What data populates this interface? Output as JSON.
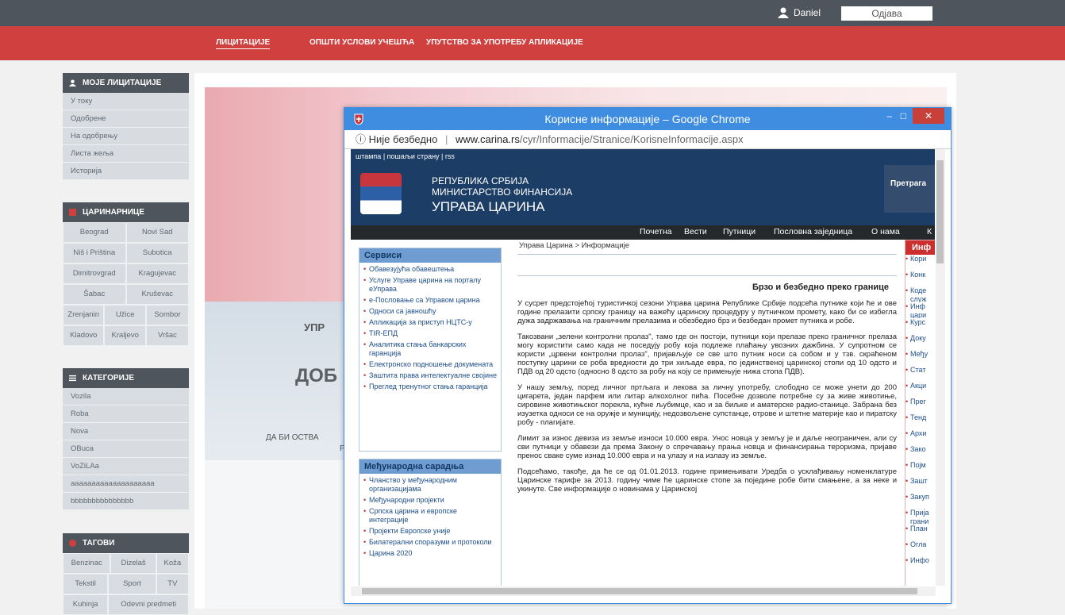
{
  "top": {
    "user": "Daniel",
    "logout": "Одјава"
  },
  "nav": {
    "items": [
      "ЛИЦИТАЦИЈЕ",
      "ОПШТИ УСЛОВИ УЧЕШЋА",
      "УПУТСТВО ЗА УПОТРЕБУ АПЛИКАЦИЈЕ"
    ]
  },
  "sidebar": {
    "auctions": {
      "title": "МОЈЕ ЛИЦИТАЦИЈЕ",
      "items": [
        "У току",
        "Одобрене",
        "На одобрењу",
        "Листа жеља",
        "Историја"
      ]
    },
    "customs": {
      "title": "ЦАРИНАРНИЦЕ",
      "items": [
        "Beograd",
        "Novi Sad",
        "Niš i Priština",
        "Subotica",
        "Dimitrovgrad",
        "Kragujevac",
        "Šabac",
        "Kruševac",
        "Zrenjanin",
        "Užice",
        "Sombor",
        "Kladovo",
        "Kraljevo",
        "Vršac"
      ]
    },
    "categories": {
      "title": "КАТЕГОРИЈЕ",
      "items": [
        "Vozila",
        "Roba",
        "Nova",
        "OBuca",
        "VoZiLAa",
        "aaaaaaaaaaaaaaaaaaaa",
        "bbbbbbbbbbbbbbb"
      ]
    },
    "tags": {
      "title": "ТАГОВИ",
      "items": [
        "Benzinac",
        "Dizelaš",
        "Koža",
        "Tekstil",
        "Sport",
        "TV",
        "Kuhinja",
        "Odevni predmeti"
      ]
    }
  },
  "hero": {
    "text1": "УПР",
    "text2": "ДОБ",
    "text3": "ДА БИ ОСТВА",
    "text4": "Р"
  },
  "browser": {
    "title": "Корисне информације – Google Chrome",
    "not_secure": "Није безбедно",
    "domain": "www.carina.rs",
    "path": "/cyr/Informacije/Stranice/KorisneInformacije.aspx",
    "minimize": "–",
    "maximize": "□",
    "close": "✕"
  },
  "site": {
    "tools": "штампа | пошаљи страну | rss",
    "line1": "РЕПУБЛИКА СРБИЈА",
    "line2": "МИНИСТАРСТВО ФИНАНСИЈА",
    "line3": "УПРАВА ЦАРИНА",
    "search": "Претрага",
    "menu": [
      "Почетна",
      "Вести",
      "Путници",
      "Пословна заједница",
      "О нама",
      "К"
    ],
    "services_title": "Сервиси",
    "services": [
      "Обавезујућа обавештења",
      "Услуге Управе царина на порталу еУправа",
      "е-Пословање са Управом царина",
      "Односи са јавношћу",
      "Апликација за приступ НЦТС-у",
      "TIR-ЕПД",
      "Аналитика стања банкарских гаранција",
      "Електронско подношење докумената",
      "Заштита права интелектуалне својине",
      "Преглед тренутног стања гаранција"
    ],
    "intl_title": "Међународна сарадња",
    "intl": [
      "Чланство у међународним организацијама",
      "Међународни пројекти",
      "Српска царина и европске интеграције",
      "Пројекти Европске уније",
      "Билатерални споразуми и протоколи",
      "Царина 2020"
    ],
    "crumb": "Управа Царина > Информације",
    "heading": "Брзо и безбедно преко границе",
    "p1": "У сусрет предстојећој туристичкој сезони Управа царина Републике Србије подсећа путнике који ће и ове године прелазити српску границу на важећу царинску процедуру у путничком промету, како би се избегла дужа задржавања на граничним прелазима и обезбедио брз и безбедан промет путника и робе.",
    "p2": "Такозвани „зелени контролни пролаз\", тамо где он постоји, путници који прелазе преко граничног прелаза могу користити само када не поседују робу која подлеже плаћању увозних дажбина. У супротном се користи „црвени контролни пролаз\", пријављује се све што путник носи са собом и у тзв. скраћеном поступку царини се роба вредности до три хиљаде евра, по јединственој царинској стопи од 10 одсто и ПДВ од 20 одсто (односно 8 одсто за робу на коју се примењује нижа стопа ПДВ).",
    "p3": "У нашу земљу, поред личног пртљага и лекова за личну употребу, слободно се може унети до 200 цигарета, један парфем или литар алкохолног пића. Посебне дозволе потребне су за живе животиње, сировине животињског порекла, кућне љубимце, као и за биљке и аматерске радио-станице. Забрана без изузетка односи се на оружје и муницију, недозвољене супстанце, отрове и штетне материје као и пиратску робу - плагијате.",
    "p4": "Лимит за износ девиза из земље износи 10.000 евра. Унос новца у земљу је и даље неограничен, али су сви путници у обавези да према Закону о спречавању прања новца и финансирања тероризма, пријаве пренос сваке суме изнад 10.000 евра и на улазу и на излазу из земље.",
    "p5": "Подсећамо, такође, да ће се од 01.01.2013. године примењивати Уредба о усклађивању номенклатуре Царинске тарифе за 2013. годину чиме ће царинске стопе за поједине робе бити смањене, а за неке и укинуте. Све информације о новинама у Царинској",
    "info_title": "Инф",
    "info": [
      "Кори",
      "Конк",
      "Коде служ",
      "Инф цари",
      "Курс",
      "Доку",
      "Међу",
      "Стат",
      "Акци",
      "Прег",
      "Тенд",
      "Архи",
      "Зако",
      "Појм",
      "Зашт",
      "Закуп",
      "Прија грани",
      "План",
      "Огла",
      "Инфо"
    ]
  }
}
